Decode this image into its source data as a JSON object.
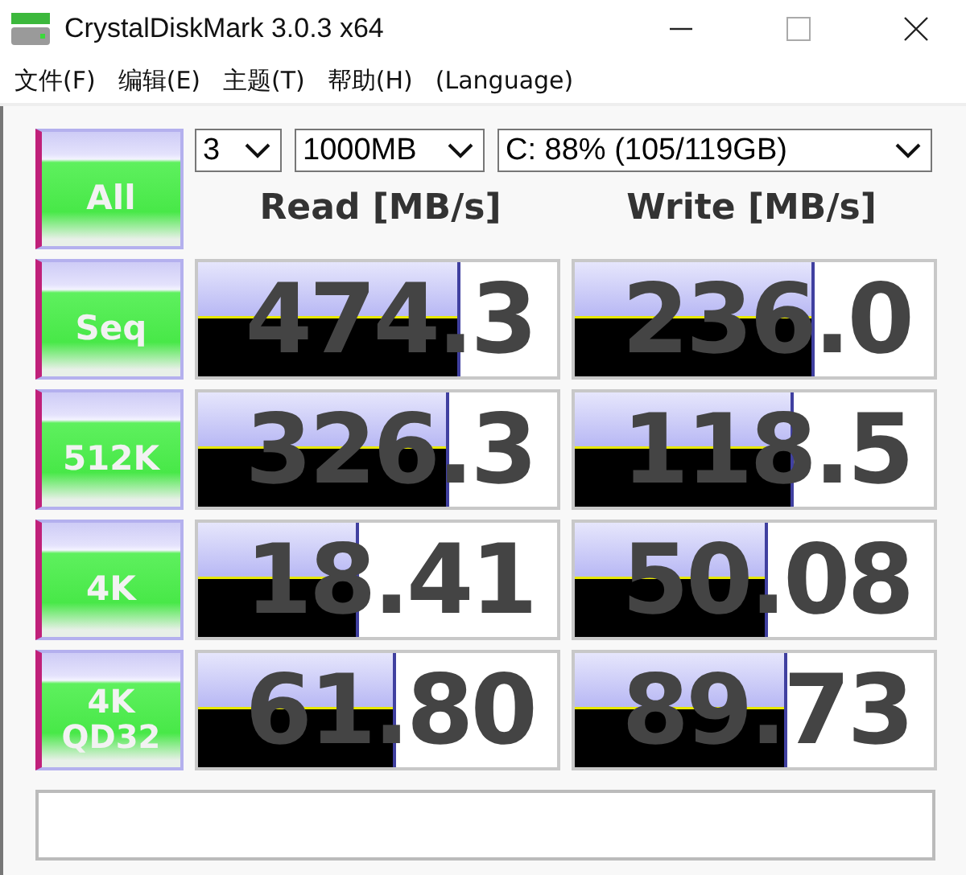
{
  "window": {
    "title": "CrystalDiskMark 3.0.3 x64"
  },
  "menu": [
    "文件(F)",
    "编辑(E)",
    "主题(T)",
    "帮助(H)",
    "(Language)"
  ],
  "all_button": "All",
  "selects": [
    {
      "value": "3",
      "kind": "small"
    },
    {
      "value": "1000MB",
      "kind": "medium"
    },
    {
      "value": "C: 88% (105/119GB)",
      "kind": "wide"
    }
  ],
  "headers": [
    "Read [MB/s]",
    "Write [MB/s]"
  ],
  "rows": [
    {
      "label_lines": [
        "Seq"
      ],
      "read": {
        "value": "474.3",
        "level": 0.73
      },
      "write": {
        "value": "236.0",
        "level": 0.67
      }
    },
    {
      "label_lines": [
        "512K"
      ],
      "read": {
        "value": "326.3",
        "level": 0.7
      },
      "write": {
        "value": "118.5",
        "level": 0.61
      }
    },
    {
      "label_lines": [
        "4K"
      ],
      "read": {
        "value": "18.41",
        "level": 0.45
      },
      "write": {
        "value": "50.08",
        "level": 0.54
      }
    },
    {
      "label_lines": [
        "4K",
        "QD32"
      ],
      "read": {
        "value": "61.80",
        "level": 0.55
      },
      "write": {
        "value": "89.73",
        "level": 0.59
      }
    }
  ]
}
